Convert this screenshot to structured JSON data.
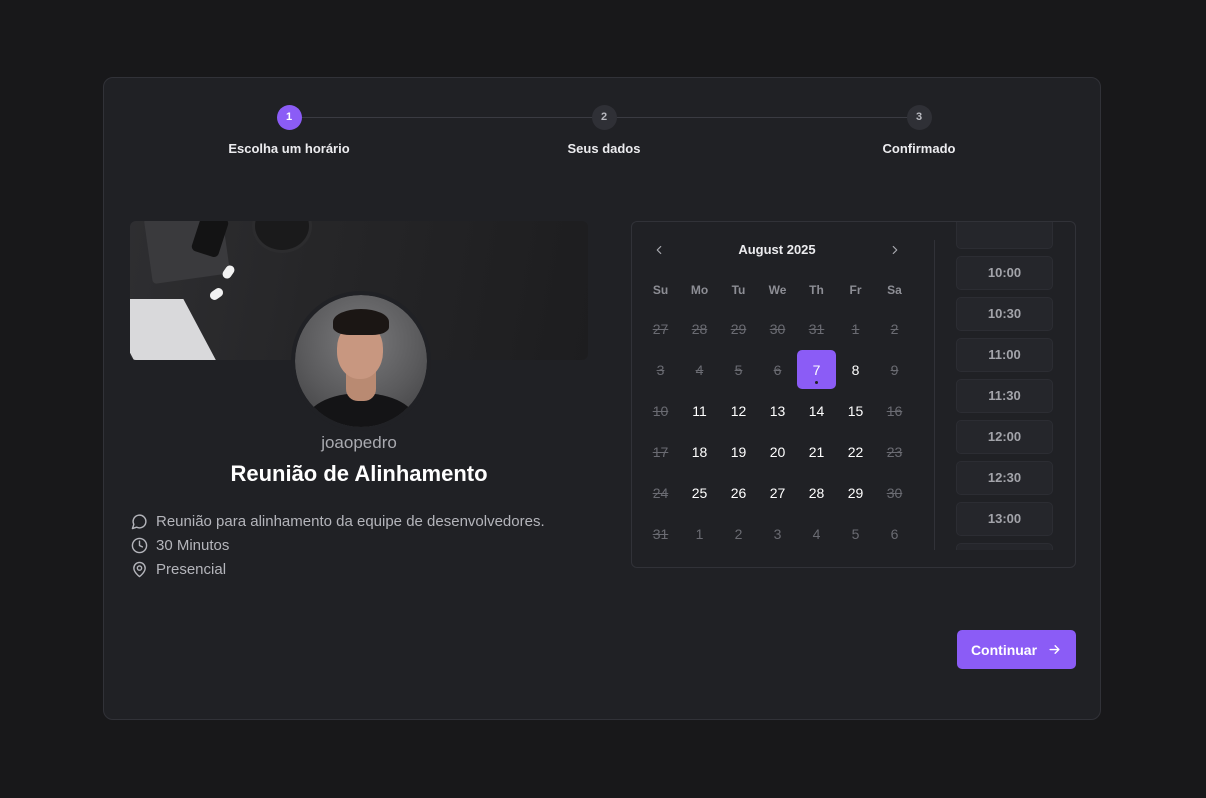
{
  "stepper": {
    "steps": [
      {
        "number": "1",
        "label": "Escolha um horário",
        "active": true
      },
      {
        "number": "2",
        "label": "Seus dados",
        "active": false
      },
      {
        "number": "3",
        "label": "Confirmado",
        "active": false
      }
    ]
  },
  "profile": {
    "username": "joaopedro",
    "event_title": "Reunião de Alinhamento",
    "description": "Reunião para alinhamento da equipe de desenvolvedores.",
    "duration": "30 Minutos",
    "location": "Presencial",
    "icons": {
      "description": "chat-bubble-icon",
      "duration": "clock-icon",
      "location": "map-pin-icon"
    }
  },
  "calendar": {
    "month_label": "August 2025",
    "weekdays": [
      "Su",
      "Mo",
      "Tu",
      "We",
      "Th",
      "Fr",
      "Sa"
    ],
    "weeks": [
      [
        {
          "d": "27",
          "s": "past"
        },
        {
          "d": "28",
          "s": "past"
        },
        {
          "d": "29",
          "s": "past"
        },
        {
          "d": "30",
          "s": "past"
        },
        {
          "d": "31",
          "s": "past"
        },
        {
          "d": "1",
          "s": "past"
        },
        {
          "d": "2",
          "s": "past"
        }
      ],
      [
        {
          "d": "3",
          "s": "past"
        },
        {
          "d": "4",
          "s": "past"
        },
        {
          "d": "5",
          "s": "past"
        },
        {
          "d": "6",
          "s": "past"
        },
        {
          "d": "7",
          "s": "selected"
        },
        {
          "d": "8",
          "s": "avail"
        },
        {
          "d": "9",
          "s": "past"
        }
      ],
      [
        {
          "d": "10",
          "s": "past"
        },
        {
          "d": "11",
          "s": "avail"
        },
        {
          "d": "12",
          "s": "avail"
        },
        {
          "d": "13",
          "s": "avail"
        },
        {
          "d": "14",
          "s": "avail"
        },
        {
          "d": "15",
          "s": "avail"
        },
        {
          "d": "16",
          "s": "past"
        }
      ],
      [
        {
          "d": "17",
          "s": "past"
        },
        {
          "d": "18",
          "s": "avail"
        },
        {
          "d": "19",
          "s": "avail"
        },
        {
          "d": "20",
          "s": "avail"
        },
        {
          "d": "21",
          "s": "avail"
        },
        {
          "d": "22",
          "s": "avail"
        },
        {
          "d": "23",
          "s": "past"
        }
      ],
      [
        {
          "d": "24",
          "s": "past"
        },
        {
          "d": "25",
          "s": "avail"
        },
        {
          "d": "26",
          "s": "avail"
        },
        {
          "d": "27",
          "s": "avail"
        },
        {
          "d": "28",
          "s": "avail"
        },
        {
          "d": "29",
          "s": "avail"
        },
        {
          "d": "30",
          "s": "past"
        }
      ],
      [
        {
          "d": "31",
          "s": "past"
        },
        {
          "d": "1",
          "s": "outside"
        },
        {
          "d": "2",
          "s": "outside"
        },
        {
          "d": "3",
          "s": "outside"
        },
        {
          "d": "4",
          "s": "outside"
        },
        {
          "d": "5",
          "s": "outside"
        },
        {
          "d": "6",
          "s": "outside"
        }
      ]
    ],
    "prev_icon": "chevron-left-icon",
    "next_icon": "chevron-right-icon"
  },
  "time_slots": [
    "",
    "10:00",
    "10:30",
    "11:00",
    "11:30",
    "12:00",
    "12:30",
    "13:00",
    ""
  ],
  "actions": {
    "continue_label": "Continuar",
    "continue_icon": "arrow-right-icon"
  },
  "colors": {
    "accent": "#8b5cf6",
    "background": "#18181a",
    "card": "#202125"
  }
}
